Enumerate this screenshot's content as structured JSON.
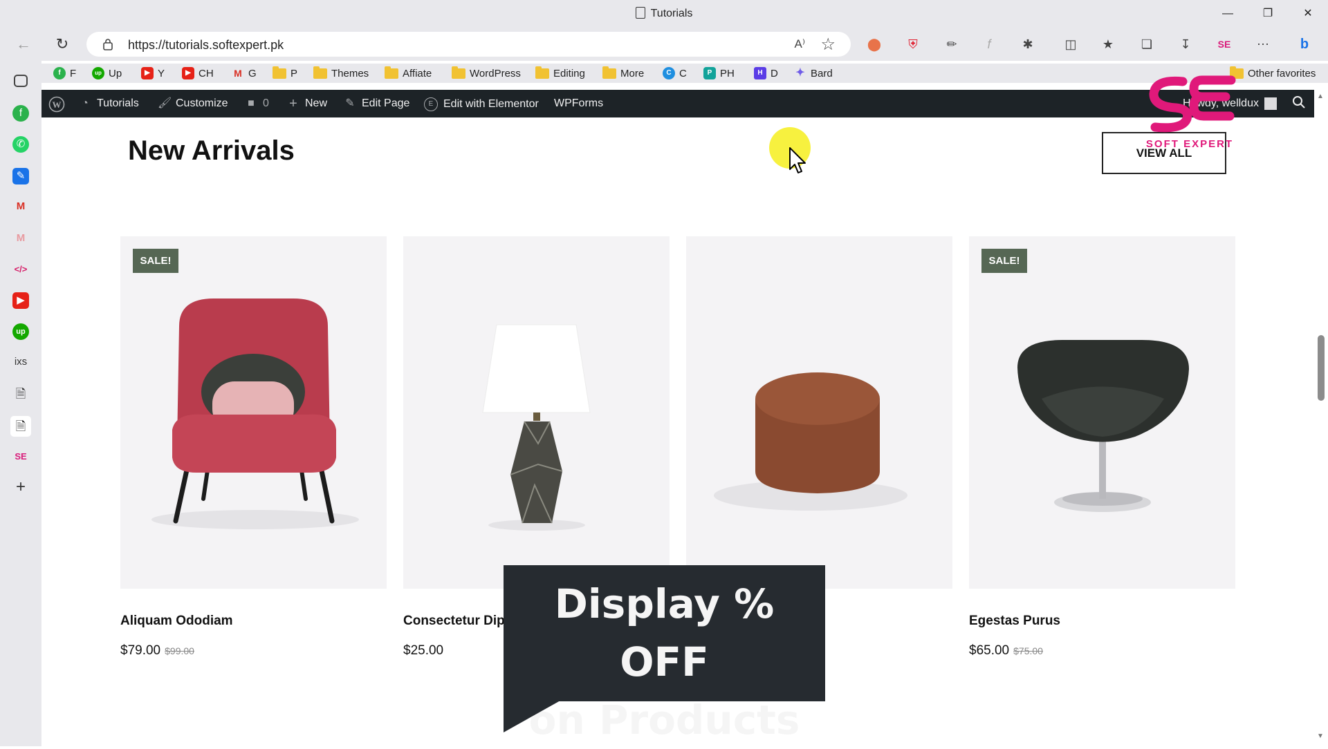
{
  "window": {
    "title": "Tutorials"
  },
  "address_bar": {
    "url": "https://tutorials.softexpert.pk",
    "read_aloud": "A⁾"
  },
  "bookmarks": [
    {
      "label": "F",
      "icon": "feedly-icon",
      "color": "#2bb24c"
    },
    {
      "label": "Up",
      "icon": "upwork-icon",
      "color": "#14a800"
    },
    {
      "label": "Y",
      "icon": "youtube-icon",
      "color": "#e62117"
    },
    {
      "label": "CH",
      "icon": "youtube-icon",
      "color": "#e62117"
    },
    {
      "label": "G",
      "icon": "gmail-icon",
      "color": "#d93025"
    },
    {
      "label": "P",
      "icon": "folder-icon"
    },
    {
      "label": "Themes",
      "icon": "folder-icon"
    },
    {
      "label": "Affiate",
      "icon": "folder-icon"
    },
    {
      "label": "WordPress",
      "icon": "folder-icon"
    },
    {
      "label": "Editing",
      "icon": "folder-icon"
    },
    {
      "label": "More",
      "icon": "folder-icon"
    },
    {
      "label": "C",
      "icon": "canva-icon",
      "color": "#1f8fe0"
    },
    {
      "label": "PH",
      "icon": "ph-icon",
      "color": "#12a39a"
    },
    {
      "label": "D",
      "icon": "d-icon",
      "color": "#5a3ce6"
    },
    {
      "label": "Bard",
      "icon": "bard-icon",
      "color": "#6f5ce8"
    }
  ],
  "other_favorites": "Other favorites",
  "wp_admin": {
    "site": "Tutorials",
    "customize": "Customize",
    "comments": "0",
    "new": "New",
    "edit_page": "Edit Page",
    "edit_elementor": "Edit with Elementor",
    "wpforms": "WPForms",
    "howdy": "Howdy, welldux"
  },
  "section": {
    "title": "New Arrivals",
    "view_all": "VIEW ALL"
  },
  "products": [
    {
      "name": "Aliquam Ododiam",
      "price": "$79.00",
      "old_price": "$99.00",
      "sale": "SALE!",
      "image": "red-lounge-chair"
    },
    {
      "name": "Consectetur Dip",
      "price": "$25.00",
      "old_price": "",
      "sale": "",
      "image": "table-lamp"
    },
    {
      "name": "",
      "price": "",
      "old_price": "",
      "sale": "",
      "image": "brown-ottoman"
    },
    {
      "name": "Egestas Purus",
      "price": "$65.00",
      "old_price": "$75.00",
      "sale": "SALE!",
      "image": "black-swivel-chair"
    }
  ],
  "caption": {
    "line1": "Display % OFF",
    "line2": "on Products"
  },
  "watermark": {
    "text": "SOFT EXPERT",
    "color": "#e0197a"
  }
}
